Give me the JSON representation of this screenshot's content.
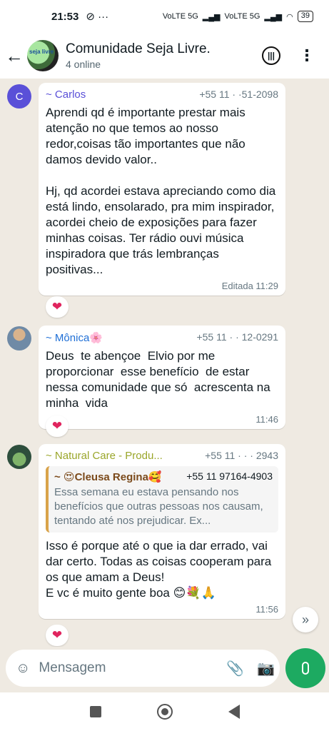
{
  "status_bar": {
    "time": "21:53",
    "extra": "⊘ ···",
    "network_1": "VoLTE 5G",
    "network_2": "VoLTE 5G",
    "battery": "39"
  },
  "header": {
    "group_name": "Comunidade Seja Livre.",
    "subtitle": "4 online",
    "avatar_text": "seja livre",
    "back_icon": "arrow-left-icon",
    "call_icon": "voice-chat-icon",
    "menu_icon": "kebab-menu-icon"
  },
  "messages": [
    {
      "avatar_letter": "C",
      "sender": "~ Carlos",
      "sender_color": "#5a50d8",
      "phone": "+55 11 ·  ·51-2098",
      "text": "Aprendi qd é importante prestar mais atenção no que temos ao nosso redor,coisas tão importantes que não damos devido valor..\n\nHj, qd acordei estava apreciando como dia está lindo, ensolarado, pra mim inspirador, acordei cheio de exposições para fazer minhas coisas. Ter rádio ouvi música inspiradora que trás lembranças positivas...",
      "meta": "Editada 11:29",
      "reaction": "❤"
    },
    {
      "sender": "~ Mônica🌸",
      "sender_color": "#1f6fd6",
      "phone": "+55 11 ·  · 12-0291",
      "text": "Deus  te abençoe  Elvio por me proporcionar  esse benefício  de estar nessa comunidade que só  acrescenta na minha  vida",
      "meta": "11:46",
      "reaction": "❤"
    },
    {
      "sender": "~ Natural Care - Produ...",
      "sender_color": "#9aa62a",
      "phone": "+55 11 ·  ·  ·  2943",
      "quote": {
        "name": "~ 😍Cleusa Regina🥰",
        "phone": "+55 11 97164-4903",
        "text": "Essa semana eu estava pensando nos benefícios que outras pessoas nos causam, tentando até nos prejudicar. Ex..."
      },
      "text": "Isso é porque até o que ia dar errado, vai dar certo. Todas as coisas cooperam para os que amam a Deus!\nE vc é muito gente boa 😊💐🙏",
      "meta": "11:56",
      "reaction": "❤"
    }
  ],
  "composer": {
    "placeholder": "Mensagem",
    "emoji_icon": "sticker-icon",
    "attach_icon": "paperclip-icon",
    "camera_icon": "camera-icon",
    "mic_icon": "microphone-icon"
  },
  "scroll_icon": "»",
  "icons": {
    "back": "←",
    "call": "⦿",
    "menu": "⋮",
    "emoji": "☺",
    "attach": "📎",
    "camera": "📷"
  }
}
